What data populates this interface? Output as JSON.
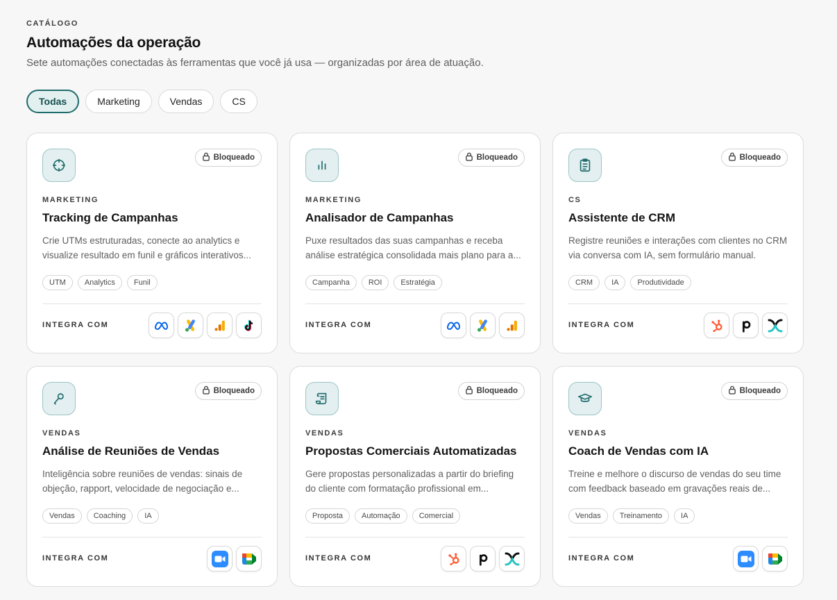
{
  "header": {
    "eyebrow": "CATÁLOGO",
    "title": "Automações da operação",
    "subtitle": "Sete automações conectadas às ferramentas que você já usa — organizadas por área de atuação."
  },
  "filters": [
    {
      "label": "Todas",
      "active": true
    },
    {
      "label": "Marketing",
      "active": false
    },
    {
      "label": "Vendas",
      "active": false
    },
    {
      "label": "CS",
      "active": false
    }
  ],
  "integra_label": "INTEGRA COM",
  "colors": {
    "accent": "#1f6b6b",
    "accent_bg": "#e3f0f0",
    "icon_bg": "#e3eff0"
  },
  "cards": [
    {
      "icon": "crosshair-icon",
      "badge": "Bloqueado",
      "category": "MARKETING",
      "title": "Tracking de Campanhas",
      "description": "Crie UTMs estruturadas, conecte ao analytics e visualize resultado em funil e gráficos interativos...",
      "tags": [
        "UTM",
        "Analytics",
        "Funil"
      ],
      "integrations": [
        "meta-icon",
        "google-ads-icon",
        "google-analytics-icon",
        "tiktok-icon"
      ]
    },
    {
      "icon": "bar-chart-icon",
      "badge": "Bloqueado",
      "category": "MARKETING",
      "title": "Analisador de Campanhas",
      "description": "Puxe resultados das suas campanhas e receba análise estratégica consolidada mais plano para a...",
      "tags": [
        "Campanha",
        "ROI",
        "Estratégia"
      ],
      "integrations": [
        "meta-icon",
        "google-ads-icon",
        "google-analytics-icon"
      ]
    },
    {
      "icon": "clipboard-icon",
      "badge": "Bloqueado",
      "category": "CS",
      "title": "Assistente de CRM",
      "description": "Registre reuniões e interações com clientes no CRM via conversa com IA, sem formulário manual.",
      "tags": [
        "CRM",
        "IA",
        "Produtividade"
      ],
      "integrations": [
        "hubspot-icon",
        "pipedrive-icon",
        "crm-x-icon"
      ]
    },
    {
      "icon": "microphone-icon",
      "badge": "Bloqueado",
      "category": "VENDAS",
      "title": "Análise de Reuniões de Vendas",
      "description": "Inteligência sobre reuniões de vendas: sinais de objeção, rapport, velocidade de negociação e...",
      "tags": [
        "Vendas",
        "Coaching",
        "IA"
      ],
      "integrations": [
        "zoom-icon",
        "google-meet-icon"
      ]
    },
    {
      "icon": "scroll-icon",
      "badge": "Bloqueado",
      "category": "VENDAS",
      "title": "Propostas Comerciais Automatizadas",
      "description": "Gere propostas personalizadas a partir do briefing do cliente com formatação profissional em...",
      "tags": [
        "Proposta",
        "Automação",
        "Comercial"
      ],
      "integrations": [
        "hubspot-icon",
        "pipedrive-icon",
        "crm-x-icon"
      ]
    },
    {
      "icon": "graduation-cap-icon",
      "badge": "Bloqueado",
      "category": "VENDAS",
      "title": "Coach de Vendas com IA",
      "description": "Treine e melhore o discurso de vendas do seu time com feedback baseado em gravações reais de...",
      "tags": [
        "Vendas",
        "Treinamento",
        "IA"
      ],
      "integrations": [
        "zoom-icon",
        "google-meet-icon"
      ]
    }
  ]
}
